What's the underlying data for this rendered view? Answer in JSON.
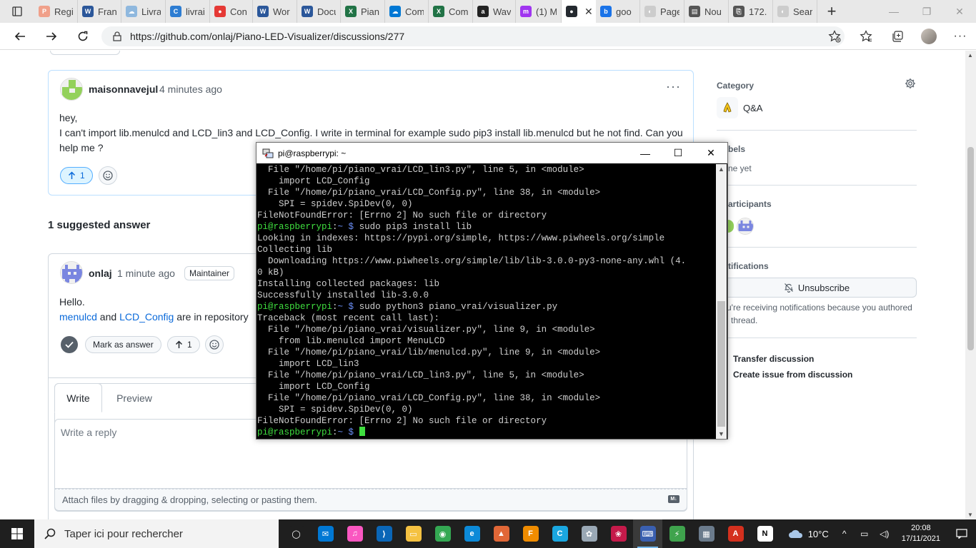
{
  "browser": {
    "tabs": [
      {
        "label": "Regi",
        "color": "#f0a08a",
        "glyph": "P"
      },
      {
        "label": "Fran",
        "color": "#2b579a",
        "glyph": "W"
      },
      {
        "label": "Livra",
        "color": "#8fb8de",
        "glyph": "☁"
      },
      {
        "label": "livrai",
        "color": "#2d7dd2",
        "glyph": "C"
      },
      {
        "label": "Con",
        "color": "#e53935",
        "glyph": "●"
      },
      {
        "label": "Wor",
        "color": "#2b579a",
        "glyph": "W"
      },
      {
        "label": "Docu",
        "color": "#2b579a",
        "glyph": "W"
      },
      {
        "label": "Pian",
        "color": "#217346",
        "glyph": "X"
      },
      {
        "label": "Com",
        "color": "#0078d4",
        "glyph": "☁"
      },
      {
        "label": "Com",
        "color": "#217346",
        "glyph": "X"
      },
      {
        "label": "Wav",
        "color": "#222222",
        "glyph": "a"
      },
      {
        "label": "(1) M",
        "color": "#a035f0",
        "glyph": "m"
      },
      {
        "label": "",
        "color": "#24292f",
        "glyph": "●",
        "active": true
      },
      {
        "label": "goo",
        "color": "#1a73e8",
        "glyph": "b"
      },
      {
        "label": "Page",
        "color": "#cccccc",
        "glyph": "◐"
      },
      {
        "label": "Nou",
        "color": "#555555",
        "glyph": "▤"
      },
      {
        "label": "172.",
        "color": "#555555",
        "glyph": "⎘"
      },
      {
        "label": "Sear",
        "color": "#cccccc",
        "glyph": "◐"
      }
    ],
    "url": "https://github.com/onlaj/Piano-LED-Visualizer/discussions/277"
  },
  "question": {
    "author": "maisonnavejul",
    "time": "4 minutes ago",
    "line1": "hey,",
    "line2": "I can't import lib.menulcd and LCD_lin3 and LCD_Config. I write in terminal for example sudo pip3 install lib.menulcd but he not find. Can you",
    "line3": "help me ?",
    "upvotes": "1"
  },
  "suggested_heading": "1 suggested answer",
  "answer": {
    "author": "onlaj",
    "time": "1 minute ago",
    "badge": "Maintainer",
    "line1": "Hello.",
    "link1": "menulcd",
    "mid": " and ",
    "link2": "LCD_Config",
    "tail": " are in repository",
    "mark_label": "Mark as answer",
    "upvotes": "1"
  },
  "reply": {
    "tab_write": "Write",
    "tab_preview": "Preview",
    "placeholder": "Write a reply",
    "attach": "Attach files by dragging & dropping, selecting or pasting them."
  },
  "sidebar": {
    "category_title": "Category",
    "category_value": "Q&A",
    "labels_title": "bels",
    "labels_value": "ne yet",
    "participants_title": "articipants",
    "notifications_title": "tifications",
    "unsubscribe": "Unsubscribe",
    "notif_line1": "u're receiving notifications because you authored",
    "notif_line2": "thread.",
    "transfer": "Transfer discussion",
    "create_issue": "Create issue from discussion"
  },
  "terminal": {
    "title": "pi@raspberrypi: ~",
    "prompt_user": "pi@raspberrypi",
    "lines": [
      {
        "t": "  File \"/home/pi/piano_vrai/LCD_lin3.py\", line 5, in <module>"
      },
      {
        "t": "    import LCD_Config"
      },
      {
        "t": "  File \"/home/pi/piano_vrai/LCD_Config.py\", line 38, in <module>"
      },
      {
        "t": "    SPI = spidev.SpiDev(0, 0)"
      },
      {
        "t": "FileNotFoundError: [Errno 2] No such file or directory"
      },
      {
        "p": true,
        "t": " sudo pip3 install lib"
      },
      {
        "t": "Looking in indexes: https://pypi.org/simple, https://www.piwheels.org/simple"
      },
      {
        "t": "Collecting lib"
      },
      {
        "t": "  Downloading https://www.piwheels.org/simple/lib/lib-3.0.0-py3-none-any.whl (4."
      },
      {
        "t": "0 kB)"
      },
      {
        "t": "Installing collected packages: lib"
      },
      {
        "t": "Successfully installed lib-3.0.0"
      },
      {
        "p": true,
        "t": " sudo python3 piano_vrai/visualizer.py"
      },
      {
        "t": "Traceback (most recent call last):"
      },
      {
        "t": "  File \"/home/pi/piano_vrai/visualizer.py\", line 9, in <module>"
      },
      {
        "t": "    from lib.menulcd import MenuLCD"
      },
      {
        "t": "  File \"/home/pi/piano_vrai/lib/menulcd.py\", line 9, in <module>"
      },
      {
        "t": "    import LCD_lin3"
      },
      {
        "t": "  File \"/home/pi/piano_vrai/LCD_lin3.py\", line 5, in <module>"
      },
      {
        "t": "    import LCD_Config"
      },
      {
        "t": "  File \"/home/pi/piano_vrai/LCD_Config.py\", line 38, in <module>"
      },
      {
        "t": "    SPI = spidev.SpiDev(0, 0)"
      },
      {
        "t": "FileNotFoundError: [Errno 2] No such file or directory"
      },
      {
        "p": true,
        "t": " ",
        "cursor": true
      }
    ]
  },
  "taskbar": {
    "search_placeholder": "Taper ici pour rechercher",
    "apps": [
      {
        "name": "task-view",
        "color": "#1f1f1f",
        "glyph": "◯"
      },
      {
        "name": "mail",
        "color": "#0078d4",
        "glyph": "✉"
      },
      {
        "name": "itunes",
        "color": "#fa57c1",
        "glyph": "♫"
      },
      {
        "name": "vscode",
        "color": "#0a66b7",
        "glyph": "⟩"
      },
      {
        "name": "file-explorer",
        "color": "#f5c242",
        "glyph": "▭"
      },
      {
        "name": "chrome",
        "color": "#34a853",
        "glyph": "◉"
      },
      {
        "name": "edge",
        "color": "#0c8ad8",
        "glyph": "e"
      },
      {
        "name": "matlab",
        "color": "#e16737",
        "glyph": "▲"
      },
      {
        "name": "fusion",
        "color": "#f08c00",
        "glyph": "F"
      },
      {
        "name": "c-app",
        "color": "#1aa7e0",
        "glyph": "C"
      },
      {
        "name": "paint",
        "color": "#9aa8b5",
        "glyph": "✿"
      },
      {
        "name": "raspberry",
        "color": "#c51a4a",
        "glyph": "❀"
      },
      {
        "name": "putty",
        "color": "#3a5fb0",
        "glyph": "⌨",
        "active": true
      },
      {
        "name": "bolt",
        "color": "#3fa34d",
        "glyph": "⚡"
      },
      {
        "name": "vm",
        "color": "#6b7b8c",
        "glyph": "▦"
      },
      {
        "name": "acrobat",
        "color": "#d4301e",
        "glyph": "A"
      },
      {
        "name": "notion",
        "color": "#ffffff",
        "glyph": "N"
      }
    ],
    "temperature": "10°C",
    "time": "20:08",
    "date": "17/11/2021"
  }
}
